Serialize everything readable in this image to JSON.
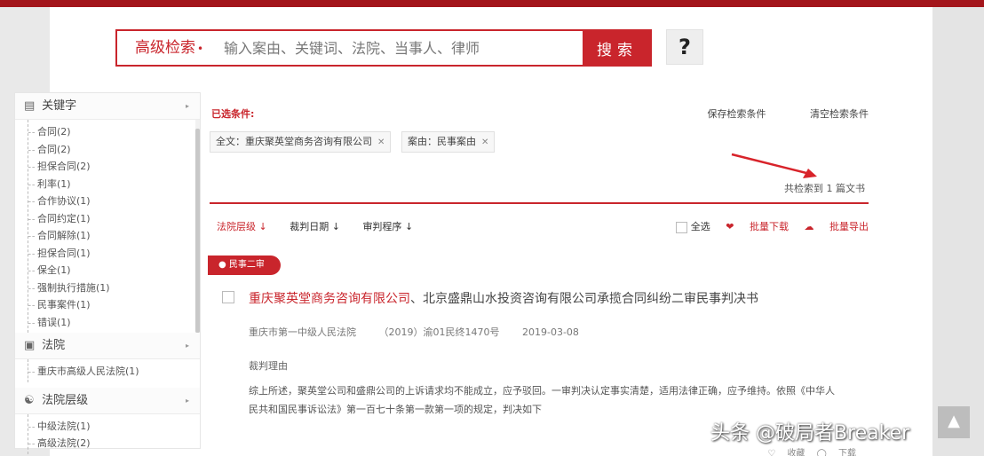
{
  "search": {
    "type_label": "高级检索",
    "placeholder": "输入案由、关键词、法院、当事人、律师",
    "button": "搜索",
    "help": "?"
  },
  "sidebar": {
    "keyword": {
      "title": "关键字",
      "items": [
        "合同(2)",
        "合同(2)",
        "担保合同(2)",
        "利率(1)",
        "合作协议(1)",
        "合同约定(1)",
        "合同解除(1)",
        "担保合同(1)",
        "保全(1)",
        "强制执行措施(1)",
        "民事案件(1)",
        "错误(1)"
      ]
    },
    "court": {
      "title": "法院",
      "items": [
        "重庆市高级人民法院(1)"
      ]
    },
    "level": {
      "title": "法院层级",
      "items": [
        "中级法院(1)",
        "高级法院(2)"
      ]
    }
  },
  "conditions": {
    "title": "已选条件:",
    "chip1": "全文：重庆聚英堂商务咨询有限公司",
    "chip2": "案由：民事案由",
    "save_link": "保存检索条件",
    "clear_link": "清空检索条件"
  },
  "results": {
    "total": "共检索到 1 篇文书",
    "sorts": [
      "法院层级",
      "裁判日期",
      "审判程序"
    ],
    "select_all": "全选",
    "batch_download": "批量下载",
    "batch_export": "批量导出",
    "tag": "民事二审",
    "doc": {
      "title_party": "重庆聚英堂商务咨询有限公司",
      "title_rest": "、北京盛鼎山水投资咨询有限公司承揽合同纠纷二审民事判决书",
      "court": "重庆市第一中级人民法院",
      "case_no": "（2019）渝01民终1470号",
      "date": "2019-03-08",
      "gist_label": "裁判理由",
      "gist": "综上所述，聚英堂公司和盛鼎公司的上诉请求均不能成立，应予驳回。一审判决认定事实清楚，适用法律正确，应予维持。依照《中华人民共和国民事诉讼法》第一百七十条第一款第一项的规定，判决如下"
    },
    "bottom_tools": [
      "收藏",
      "下载"
    ]
  },
  "watermark": "头条 @破局者Breaker",
  "colors": {
    "brand_red": "#c9252c",
    "top_bar": "#a3151b"
  }
}
